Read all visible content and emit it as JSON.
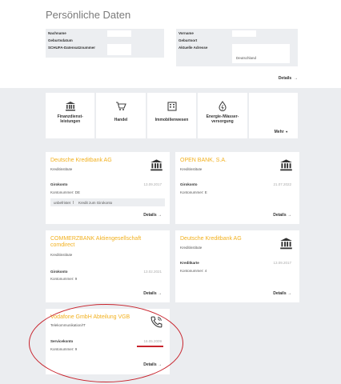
{
  "page_title": "Persönliche Daten",
  "personal": {
    "left": [
      {
        "label": "Nachname"
      },
      {
        "label": "Geburtsdatum"
      },
      {
        "label": "SCHUFA-Datensatznummer"
      }
    ],
    "right": [
      {
        "label": "Vorname"
      },
      {
        "label": "Geburtsort"
      },
      {
        "label": "Aktuelle Adresse",
        "value": "Deutschland"
      }
    ],
    "details_label": "Details"
  },
  "categories": [
    {
      "label": "Finanzdienst- leistungen",
      "icon": "bank-icon"
    },
    {
      "label": "Handel",
      "icon": "shopping-cart-icon"
    },
    {
      "label": "Immobilienwesen",
      "icon": "building-icon"
    },
    {
      "label": "Energie-/Wasser- versorgung",
      "icon": "energy-drop-icon"
    },
    {
      "label": "Mehr",
      "icon": "chevron-down-icon"
    }
  ],
  "cards": [
    {
      "title": "Deutsche Kreditbank AG",
      "subtitle": "Kreditinstitute",
      "account_type": "Girokonto",
      "date": "13.09.2017",
      "account_number": "Kontonummer: DE",
      "tags": [
        "unbefristet",
        "Kredit zum Girokonto"
      ],
      "details": "Details",
      "icon": "bank-icon"
    },
    {
      "title": "OPEN BANK, S.A.",
      "subtitle": "Kreditinstitute",
      "account_type": "Girokonto",
      "date": "21.07.2022",
      "account_number": "Kontonummer: E",
      "details": "Details",
      "icon": "bank-icon"
    },
    {
      "title": "COMMERZBANK Aktiengesellschaft comdirect",
      "subtitle": "Kreditinstitute",
      "account_type": "Girokonto",
      "date": "13.02.2021",
      "account_number": "Kontonummer: 9",
      "details": "Details",
      "icon": "bank-icon"
    },
    {
      "title": "Deutsche Kreditbank AG",
      "subtitle": "Kreditinstitute",
      "account_type": "Kreditkarte",
      "date": "13.09.2017",
      "account_number": "Kontonummer: 4",
      "details": "Details",
      "icon": "bank-icon"
    },
    {
      "title": "Vodafone GmbH Abteilung VGB",
      "subtitle": "Telekommunikation/IT",
      "account_type": "Servicekonto",
      "date": "16.05.2009",
      "account_number": "Kontonummer: 9",
      "details": "Details",
      "icon": "phone-icon"
    }
  ],
  "colors": {
    "accent": "#f2b01e",
    "highlight": "#c8232c",
    "background": "#ebedf0"
  }
}
